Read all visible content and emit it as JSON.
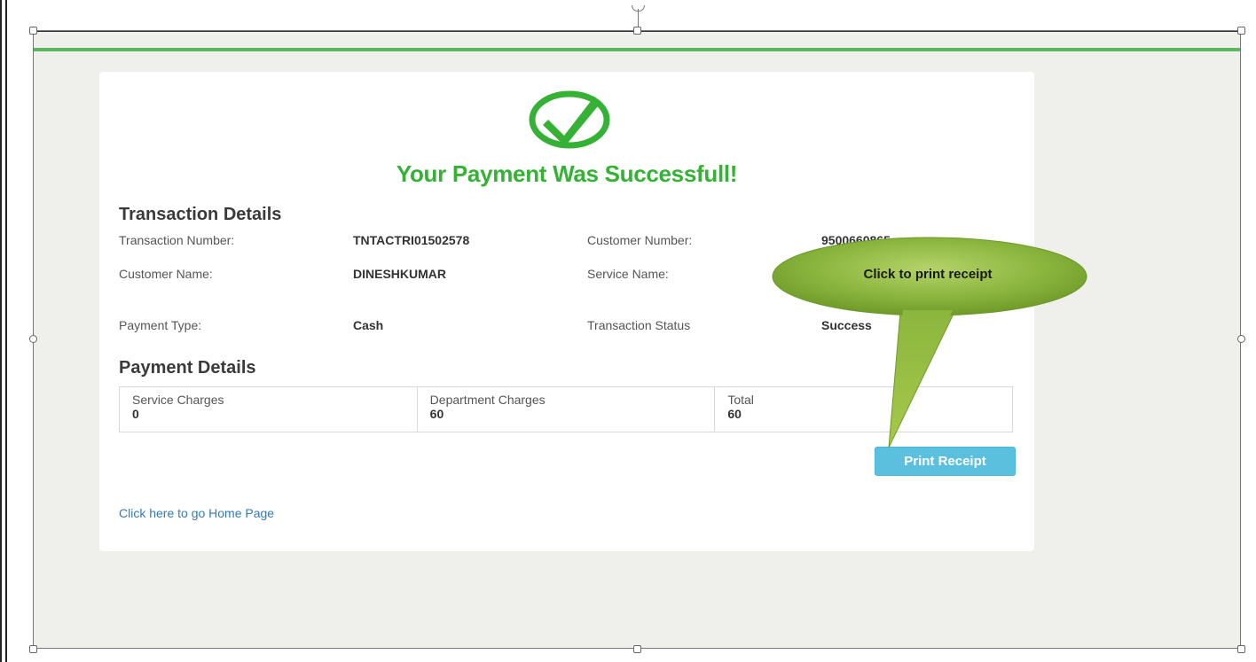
{
  "payment": {
    "title": "Your Payment Was Successfull!",
    "transaction_section": "Transaction Details",
    "transaction_number_label": "Transaction Number:",
    "transaction_number": "TNTACTRI01502578",
    "customer_number_label": "Customer Number:",
    "customer_number": "9500660865",
    "customer_name_label": "Customer Name:",
    "customer_name": "DINESHKUMAR",
    "service_name_label": "Service Name:",
    "payment_type_label": "Payment Type:",
    "payment_type": "Cash",
    "transaction_status_label": "Transaction Status",
    "transaction_status": "Success",
    "payment_section": "Payment Details",
    "charges": [
      {
        "label": "Service Charges",
        "value": "0"
      },
      {
        "label": "Department Charges",
        "value": "60"
      },
      {
        "label": "Total",
        "value": "60"
      }
    ],
    "print_button": "Print Receipt",
    "home_link": "Click here to go Home Page"
  },
  "callout": {
    "text": "Click to print receipt"
  },
  "colors": {
    "success_green": "#35b135",
    "button_blue": "#5bc0de",
    "link_blue": "#337ab7",
    "callout_green": "#8bb63e"
  },
  "icons": {
    "success": "check-circle-icon"
  }
}
